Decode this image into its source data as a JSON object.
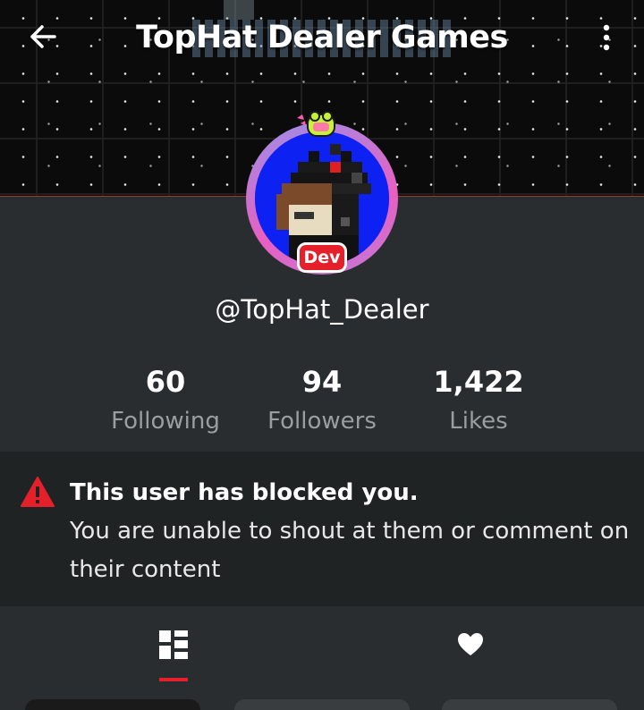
{
  "header": {
    "title": "TopHat Dealer Games",
    "back_icon": "arrow-left-icon",
    "menu_icon": "more-vertical-icon"
  },
  "profile": {
    "badge": "Dev",
    "username": "@TopHat_Dealer",
    "stats": [
      {
        "value": "60",
        "label": "Following"
      },
      {
        "value": "94",
        "label": "Followers"
      },
      {
        "value": "1,422",
        "label": "Likes"
      }
    ]
  },
  "notice": {
    "icon": "warning-icon",
    "title": "This user has blocked you.",
    "body": "You are unable to shout at them or comment on their content"
  },
  "tabs": [
    {
      "icon": "grid-icon",
      "active": true
    },
    {
      "icon": "heart-icon",
      "active": false
    }
  ],
  "colors": {
    "accent": "#e6202a",
    "background": "#2a2d2f",
    "notice_bg": "#202324",
    "muted_text": "#9a9ea1"
  }
}
